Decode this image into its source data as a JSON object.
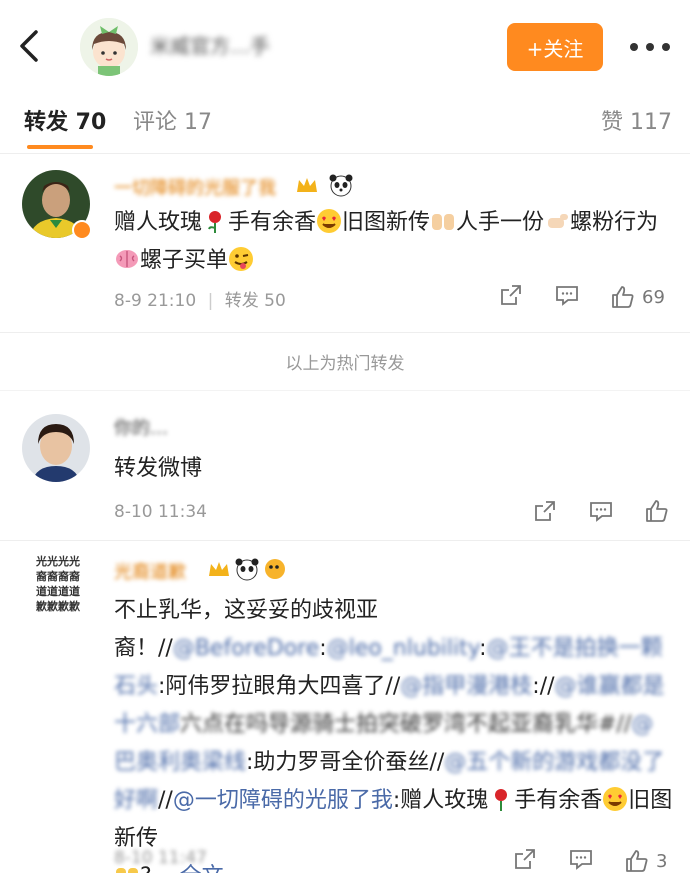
{
  "header": {
    "back_icon": "chevron-left-icon",
    "account_name": "米威官方…手",
    "follow_label": "+关注",
    "more_icon": "more-dots-icon",
    "accent": "#ff8a1f"
  },
  "tabs": [
    {
      "label": "转发 70",
      "active": true
    },
    {
      "label": "评论 17",
      "active": false
    },
    {
      "label": "赞 117",
      "active": false
    }
  ],
  "hot_post": {
    "author": "一切障碍的光服了我",
    "text_parts": [
      "赠人玫瑰",
      "手有余香",
      "旧图新传",
      "人手一份",
      "螺粉行为",
      "螺子买单"
    ],
    "time": "8-9 21:10",
    "repost_label": "转发 50",
    "likes": "69"
  },
  "section_label": "以上为热门转发",
  "post2": {
    "author": "你的…",
    "text": "转发微博",
    "time": "8-10 11:34"
  },
  "post3": {
    "avatar_text": [
      "光光光光",
      "裔裔裔裔",
      "道道道道",
      "歉歉歉歉"
    ],
    "author": "光裔道歉",
    "seg1": "不止乳华，这妥妥的歧视亚裔！//",
    "mention1": "@BeforeDore",
    "seg2": ":",
    "mention2": "@leo_nlubility",
    "seg3": ":",
    "mention3": "@王不是拍换一颗石头",
    "seg4": ":阿伟罗拉眼角大四喜了//",
    "mention4": "@指甲漫港枝",
    "seg5": "://",
    "mention5": "@谁赢都是十六部",
    "seg6": "六点在吗导源骑士拍突破罗湾不起亚裔乳华#//",
    "mention6": "@巴奥利奥梁线",
    "seg7": ":助力罗哥全价蚕丝//",
    "mention7": "@五个新的游戏都没了好啊",
    "seg8": "//",
    "mention8": "@一切障碍的光服了我",
    "seg9": ":赠人玫瑰",
    "seg10": "手有余香",
    "seg11": "旧图新传",
    "seg12": "?... ",
    "fulltext_label": "全文",
    "time": "8-10 11:47",
    "likes": "3"
  },
  "icons": {
    "share": "share-icon",
    "comment": "comment-icon",
    "like": "thumbs-up-icon",
    "rose": "rose-emoji",
    "heart_eyes": "heart-eyes-emoji",
    "hands": "open-hands-emoji",
    "thumb": "thumb-emoji",
    "brain": "brain-emoji",
    "wink": "wink-tongue-emoji",
    "crown": "crown-emoji",
    "panda": "panda-emoji",
    "fish": "pufferfish-emoji"
  }
}
